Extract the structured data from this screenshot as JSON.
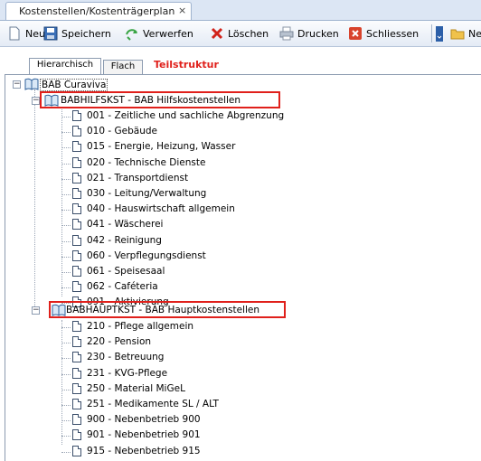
{
  "tab": {
    "title": "Kostenstellen/Kostenträgerplan",
    "close": "×"
  },
  "toolbar": {
    "neu": "Neu",
    "speichern": "Speichern",
    "verwerfen": "Verwerfen",
    "loeschen": "Löschen",
    "drucken": "Drucken",
    "schliessen": "Schliessen",
    "ne": "Ne"
  },
  "subtabs": {
    "hierarchisch": "Hierarchisch",
    "flach": "Flach",
    "teilstruktur": "Teilstruktur"
  },
  "tree": {
    "root": "BAB Curaviva",
    "group1": {
      "label": "BABHILFSKST - BAB Hilfskostenstellen",
      "items": [
        "001 - Zeitliche und sachliche Abgrenzung",
        "010 - Gebäude",
        "015 - Energie, Heizung, Wasser",
        "020 - Technische Dienste",
        "021 - Transportdienst",
        "030 - Leitung/Verwaltung",
        "040 - Hauswirtschaft allgemein",
        "041 - Wäscherei",
        "042 - Reinigung",
        "060 - Verpflegungsdienst",
        "061 - Speisesaal",
        "062 - Caféteria",
        "091 - Aktivierung"
      ]
    },
    "group2": {
      "label": "BABHAUPTKST - BAB Hauptkostenstellen",
      "items": [
        "210 - Pflege allgemein",
        "220 - Pension",
        "230 - Betreuung",
        "231 - KVG-Pflege",
        "250 - Material MiGeL",
        "251 - Medikamente SL / ALT",
        "900 - Nebenbetrieb 900",
        "901 - Nebenbetrieb 901",
        "915 - Nebenbetrieb 915"
      ]
    }
  },
  "colors": {
    "highlight": "#e0201b",
    "toolbar_bg": "#e4ebf5"
  }
}
